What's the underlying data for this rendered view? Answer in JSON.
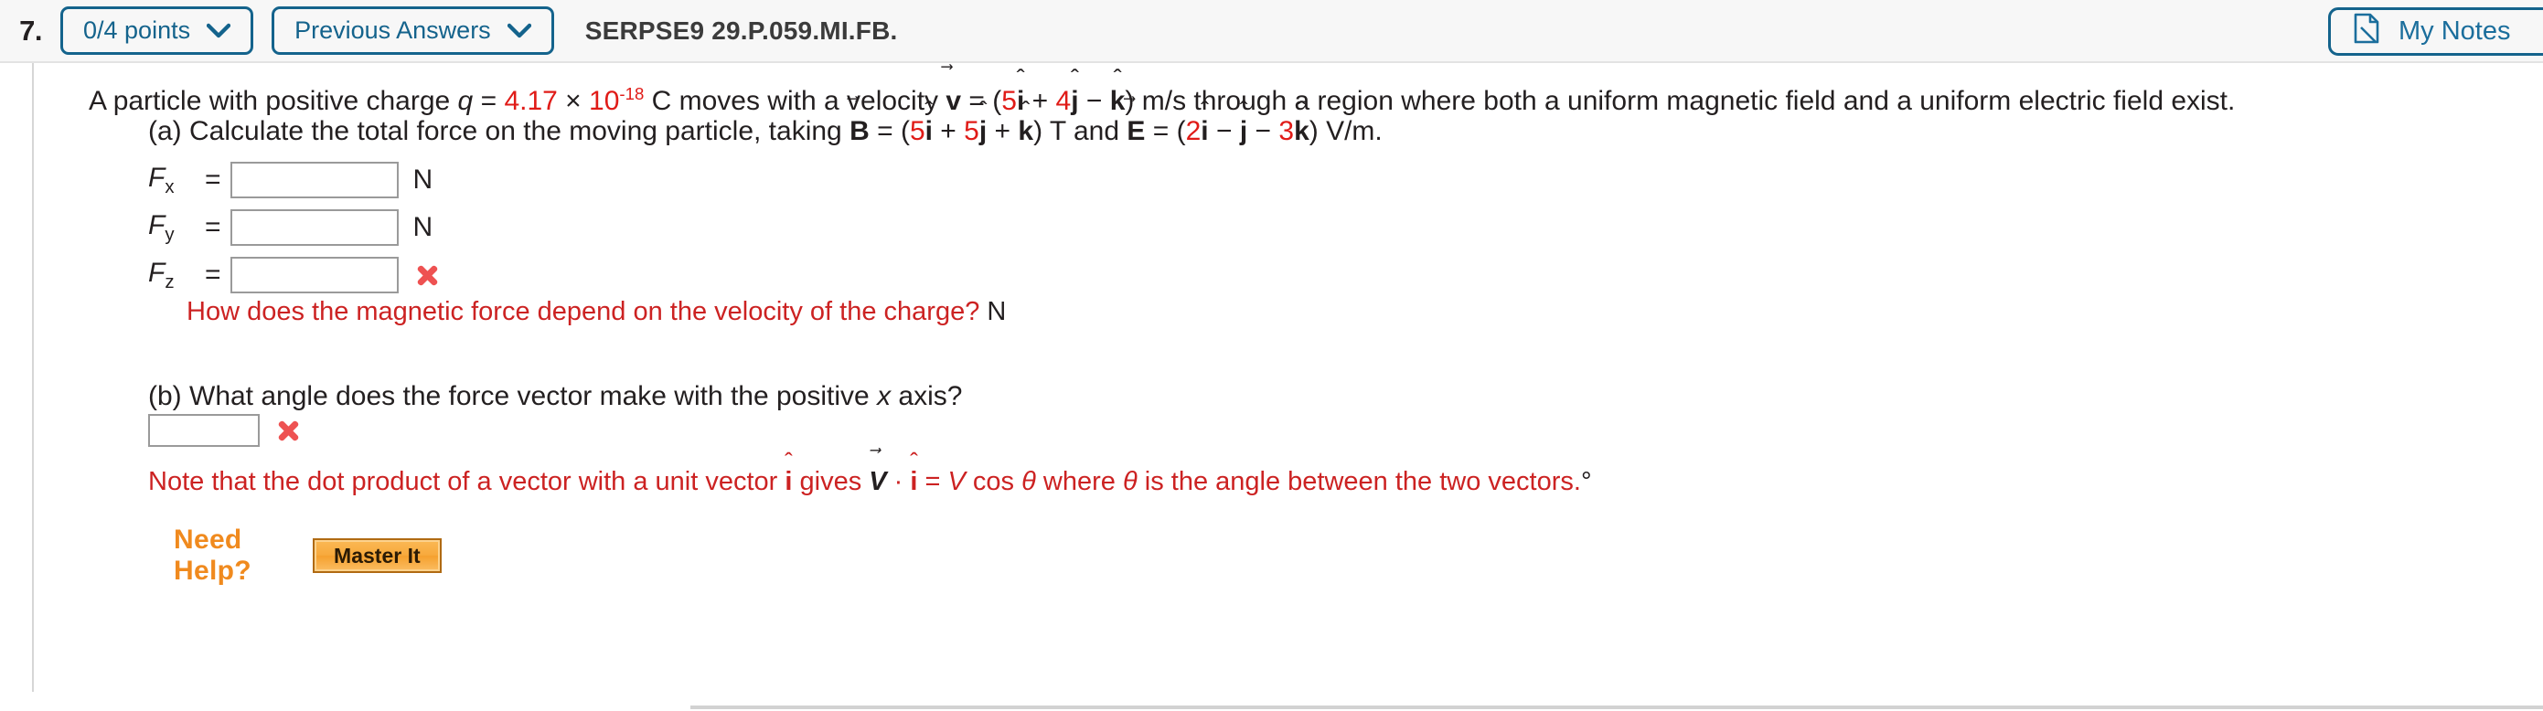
{
  "header": {
    "question_number": "7.",
    "points_label": "0/4 points",
    "previous_answers_label": "Previous Answers",
    "question_code": "SERPSE9 29.P.059.MI.FB.",
    "my_notes_label": "My Notes",
    "accent_color": "#14638c",
    "background_color": "#f7f7f7"
  },
  "stem": {
    "t1": "A particle with positive charge ",
    "q_var": "q",
    "eq1": " = ",
    "charge_mantissa": "4.17",
    "times": " × ",
    "charge_base": "10",
    "charge_exp": "-18",
    "t2": " C moves with a velocity ",
    "v_symbol": "v",
    "v_accent": "⃗",
    "eq2": " = (",
    "v_i_coeff": "5",
    "i_hat": "i",
    "hat_accent": "̂",
    "v_plus": " + ",
    "v_j_coeff": "4",
    "j_hat": "j",
    "v_minus": " − ",
    "k_hat": "k",
    "t3": ") m/s through a region where both a uniform magnetic field and a uniform electric field exist."
  },
  "part_a": {
    "label": "(a) Calculate the total force on the moving particle, taking ",
    "B_symbol": "B",
    "eqB": " = (",
    "B_i_coeff": "5",
    "B_plus1": " + ",
    "B_j_coeff": "5",
    "B_plus2": " + ",
    "B_tail": ") T and ",
    "E_symbol": "E",
    "eqE": " = (",
    "E_i_coeff": "2",
    "E_minus1": " − ",
    "E_minus2": " − ",
    "E_k_coeff": "3",
    "E_tail": ") V/m.",
    "rows": [
      {
        "var": "F",
        "sub": "x",
        "equals": "=",
        "value": "",
        "placeholder": "",
        "unit": "N",
        "wrong": false
      },
      {
        "var": "F",
        "sub": "y",
        "equals": "=",
        "value": "",
        "placeholder": "",
        "unit": "N",
        "wrong": false
      },
      {
        "var": "F",
        "sub": "z",
        "equals": "=",
        "value": "",
        "placeholder": "",
        "unit": "",
        "wrong": true
      }
    ],
    "feedback": "How does the magnetic force depend on the velocity of the charge?",
    "feedback_unit": " N"
  },
  "part_b": {
    "label_pre": "(b) What angle does the force vector make with the positive ",
    "label_var": "x",
    "label_post": " axis?",
    "value": "",
    "placeholder": "",
    "wrong": true,
    "note_pre": "Note that the dot product of a vector with a unit vector ",
    "note_i_hat": "i",
    "note_gives": " gives ",
    "note_V": "V",
    "note_dot": " · ",
    "note_eq": " = ",
    "note_Vcos": "V",
    "note_cos": " cos ",
    "note_theta": "θ",
    "note_where": " where ",
    "note_theta2": "θ",
    "note_tail": " is the angle between the two vectors.",
    "note_degree": "°"
  },
  "help": {
    "need_help_label": "Need Help?",
    "master_it_label": "Master It",
    "accent_color": "#f08a1e"
  }
}
